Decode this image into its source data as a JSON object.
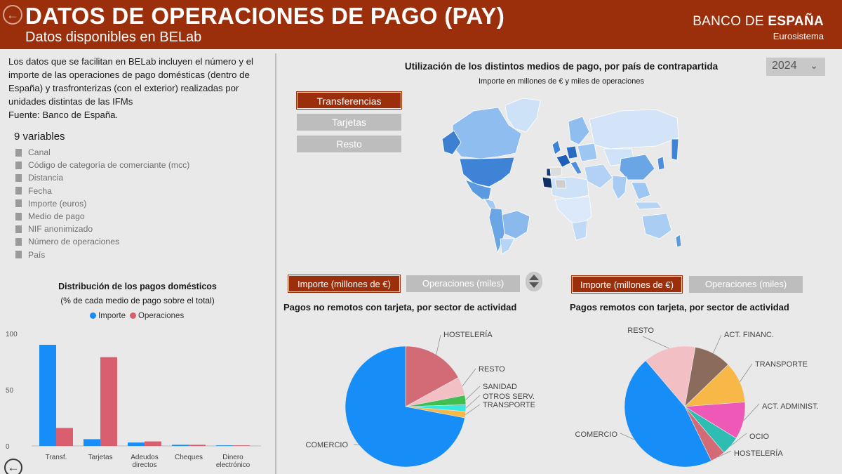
{
  "header": {
    "title": "DATOS DE OPERACIONES DE PAGO (PAY)",
    "subtitle": "Datos disponibles en BELab",
    "brand_left": "BANCO DE ",
    "brand_bold": "ESPAÑA",
    "brand_sub": "Eurosistema",
    "back_icon": "back-arrow-icon",
    "color": "#9b2f0c"
  },
  "description": {
    "line1": "Los datos que se facilitan en BELab incluyen el número y el",
    "line2": "importe de las operaciones de pago domésticas (dentro de",
    "line3": "España) y trasfronterizas (con el exterior) realizadas por",
    "line4": "unidades distintas de las IFMs",
    "line5": "Fuente: Banco de España."
  },
  "variables": {
    "title": "9 variables",
    "items": [
      "Canal",
      "Código de categoría de comerciante (mcc)",
      "Distancia",
      "Fecha",
      "Importe (euros)",
      "Medio de pago",
      "NIF anonimizado",
      "Número de operaciones",
      "País"
    ]
  },
  "map": {
    "title": "Utilización de los distintos medios de pago, por país de contrapartida",
    "subtitle": "Importe en millones de € y miles de operaciones",
    "year": "2024",
    "buttons": [
      "Transferencias",
      "Tarjetas",
      "Resto"
    ]
  },
  "toggles": {
    "importe": "Importe (millones de €)",
    "operaciones": "Operaciones (miles)"
  },
  "chart_data": [
    {
      "type": "bar",
      "title": "Distribución de los pagos domésticos",
      "subtitle": "(% de cada medio de pago sobre el total)",
      "categories": [
        [
          "Transf."
        ],
        [
          "Tarjetas"
        ],
        [
          "Adeudos",
          "directos"
        ],
        [
          "Cheques"
        ],
        [
          "Dinero",
          "electrónico"
        ]
      ],
      "series": [
        {
          "name": "Importe",
          "color": "#168df7",
          "values": [
            90,
            6,
            3,
            1,
            0.5
          ]
        },
        {
          "name": "Operaciones",
          "color": "#d95f6e",
          "values": [
            16,
            79,
            4,
            1,
            0.5
          ]
        }
      ],
      "yticks": [
        0,
        50,
        100
      ],
      "ylim": [
        0,
        100
      ]
    },
    {
      "type": "pie",
      "title": "Pagos no remotos con tarjeta, por sector de actividad",
      "slices": [
        {
          "label": "HOSTELERÍA",
          "value": 17,
          "color": "#d36b77"
        },
        {
          "label": "RESTO",
          "value": 5,
          "color": "#f2c0c4"
        },
        {
          "label": "SANIDAD",
          "value": 2.5,
          "color": "#3fbf4f"
        },
        {
          "label": "OTROS SERV.",
          "value": 1.8,
          "color": "#38e8e0"
        },
        {
          "label": "TRANSPORTE",
          "value": 1.7,
          "color": "#f7b847"
        },
        {
          "label": "COMERCIO",
          "value": 72,
          "color": "#168df7"
        }
      ]
    },
    {
      "type": "pie",
      "title": "Pagos remotos con tarjeta, por sector de actividad",
      "slices": [
        {
          "label": "ACT. FINANC.",
          "value": 10,
          "color": "#8b6c5c"
        },
        {
          "label": "TRANSPORTE",
          "value": 11,
          "color": "#f7b847"
        },
        {
          "label": "ACT. ADMINIST.",
          "value": 10,
          "color": "#ee59b8"
        },
        {
          "label": "OCIO",
          "value": 5,
          "color": "#2ebdb2"
        },
        {
          "label": "HOSTELERÍA",
          "value": 4,
          "color": "#d36b77"
        },
        {
          "label": "COMERCIO",
          "value": 46,
          "color": "#168df7"
        },
        {
          "label": "RESTO",
          "value": 14,
          "color": "#f2c0c4"
        }
      ]
    }
  ]
}
